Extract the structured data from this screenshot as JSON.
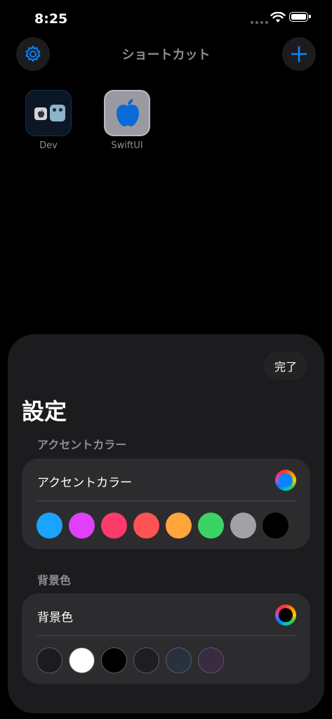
{
  "status_bar": {
    "time": "8:25"
  },
  "nav": {
    "title": "ショートカット",
    "settings_icon": "gear-icon",
    "add_icon": "plus-icon",
    "accent": "#0a84ff"
  },
  "shortcuts": [
    {
      "label": "Dev",
      "icon": "dev-shortcut-icon"
    },
    {
      "label": "SwiftUI",
      "icon": "apple-logo-icon"
    }
  ],
  "sheet": {
    "done_label": "完了",
    "title": "設定",
    "accent_section": {
      "header": "アクセントカラー",
      "row_label": "アクセントカラー",
      "selected_color": "#0a84ff",
      "swatches": [
        "#1aa3ff",
        "#e040fb",
        "#ff3b6b",
        "#ff5252",
        "#ffa53c",
        "#3ad466",
        "#a1a1a6",
        "#000000"
      ]
    },
    "background_section": {
      "header": "背景色",
      "row_label": "背景色",
      "selected_color": "#000000",
      "swatches": [
        "#1c1c1e",
        "#ffffff",
        "#000000",
        "#1d1d22",
        "#28323f",
        "#3a2a42"
      ]
    }
  }
}
